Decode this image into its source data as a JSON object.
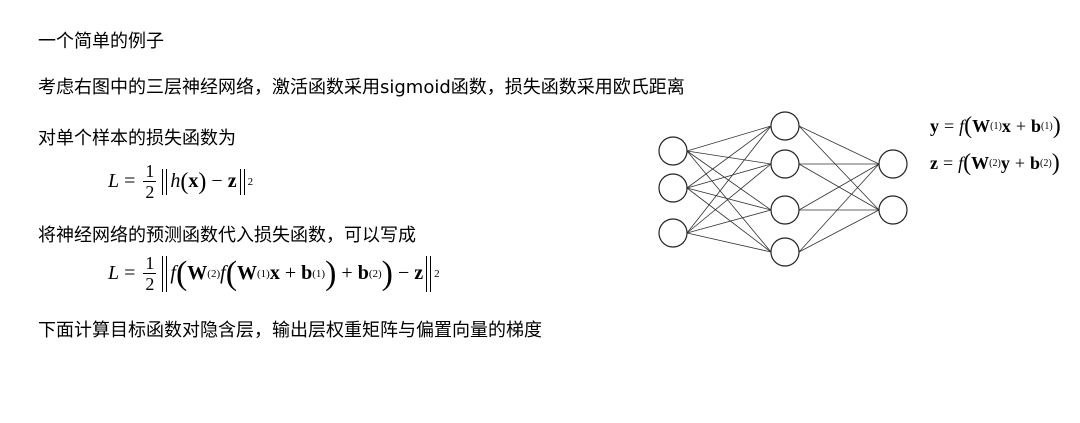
{
  "text": {
    "title": "一个简单的例子",
    "line1": "考虑右图中的三层神经网络，激活函数采用sigmoid函数，损失函数采用欧氏距离",
    "line2": "对单个样本的损失函数为",
    "line3": "将神经网络的预测函数代入损失函数，可以写成",
    "line4": "下面计算目标函数对隐含层，输出层权重矩阵与偏置向量的梯度"
  },
  "formula1": {
    "lhs": "L",
    "eq": "=",
    "frac_num": "1",
    "frac_den": "2",
    "h": "h",
    "x": "x",
    "minus": "−",
    "z": "z",
    "power": "2"
  },
  "formula2": {
    "lhs": "L",
    "eq": "=",
    "frac_num": "1",
    "frac_den": "2",
    "f": "f",
    "W": "W",
    "sup2": "(2)",
    "sup1": "(1)",
    "x": "x",
    "plus": "+",
    "b": "b",
    "minus": "−",
    "z": "z",
    "power": "2"
  },
  "right_eqs": {
    "y": "y",
    "z": "z",
    "eq": "=",
    "f": "f",
    "W": "W",
    "x": "x",
    "b": "b",
    "plus": "+",
    "sup1": "(1)",
    "sup2": "(2)"
  },
  "network": {
    "layers": [
      3,
      4,
      2
    ],
    "node_stroke": "#222222",
    "edge_stroke": "#333333"
  }
}
